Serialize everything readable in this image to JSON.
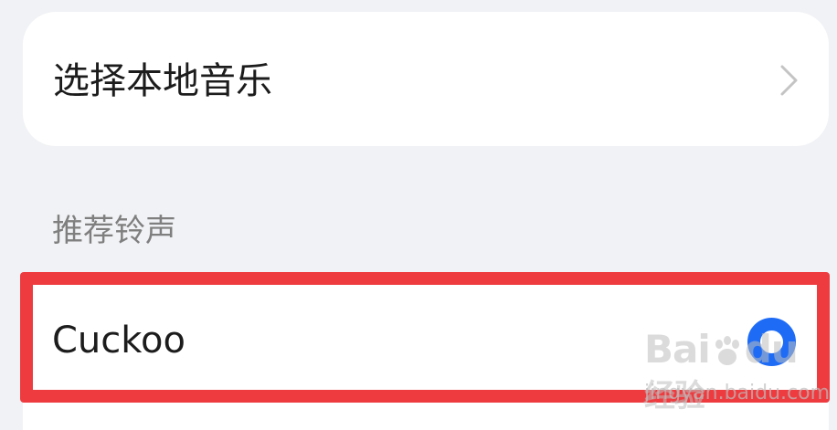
{
  "local_music": {
    "label": "选择本地音乐",
    "chevron_icon": "chevron-right-icon"
  },
  "section": {
    "title": "推荐铃声"
  },
  "ringtone": {
    "name": "Cuckoo",
    "selected": true,
    "radio_icon": "radio-selected-icon",
    "radio_color": "#1e6cf6"
  },
  "highlight_color": "#ee3b3f",
  "watermark": {
    "logo_text": "Bai",
    "logo_text2": "du",
    "logo_text3": "经验",
    "url": "jingyan.baidu.com"
  }
}
